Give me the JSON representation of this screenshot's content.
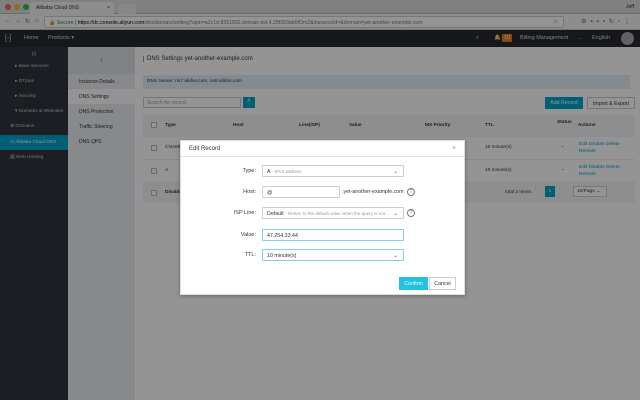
{
  "browser": {
    "tab_title": "Alibaba Cloud DNS",
    "tab_close": "×",
    "user": "Jeff",
    "url_secure": "Secure",
    "url_host": "https://dc.console.aliyun.com",
    "url_rest": "/dns/domain/setting?spm=a2c1d.8251892.domain-list.4.28f399ab0fOm2&instanceId=&domain=yet-another-example.com"
  },
  "header": {
    "home": "Home",
    "products": "Products ▾",
    "notifications": "10",
    "billing": "Billing Management",
    "more": "...",
    "language": "English"
  },
  "sidebar": {
    "items": [
      {
        "label": "Base services"
      },
      {
        "label": "DTplus"
      },
      {
        "label": "Security"
      },
      {
        "label": "Domains & Websites"
      },
      {
        "label": "Domains"
      },
      {
        "label": "Alibaba Cloud DNS"
      },
      {
        "label": "Web Hosting"
      }
    ]
  },
  "subnav": {
    "items": [
      {
        "label": "Instance Details"
      },
      {
        "label": "DNS Settings"
      },
      {
        "label": "DNS Protection"
      },
      {
        "label": "Traffic Steering"
      },
      {
        "label": "DNS QPS"
      }
    ]
  },
  "main": {
    "title": "DNS Settings yet-another-example.com",
    "dns_server": "DNS Server: ns7.alidns.com, ns8.alidns.com",
    "search_placeholder": "Search for record.",
    "add_record": "Add Record",
    "import_export": "Import & Export",
    "columns": [
      "Type",
      "Host",
      "Line(ISP)",
      "Value",
      "MX Priority",
      "TTL",
      "Status",
      "Actions"
    ],
    "rows": [
      {
        "type": "CNAME",
        "ttl": "10 minute(s)",
        "status": "--",
        "actions": [
          "Edit",
          "Disable",
          "Delete",
          "Remark"
        ]
      },
      {
        "type": "A",
        "ttl": "10 minute(s)",
        "status": "--",
        "actions": [
          "Edit",
          "Disable",
          "Delete",
          "Remark"
        ]
      }
    ],
    "footer": {
      "disable": "Disable",
      "total": "total 2 items",
      "page": "1",
      "per_page": "10/Page"
    }
  },
  "modal": {
    "title": "Edit Record",
    "type_label": "Type:",
    "type_value": "A",
    "type_hint": "- IPV4 address",
    "host_label": "Host:",
    "host_value": "@",
    "host_suffix": ".yet-another-example.com",
    "isp_label": "ISP Line:",
    "isp_value": "Default",
    "isp_hint": "- Return to the default value when the query is not...",
    "value_label": "Value:",
    "value_value": "47.254.33.44",
    "ttl_label": "TTL:",
    "ttl_value": "10 minute(s)",
    "confirm": "Confirm",
    "cancel": "Cancel"
  },
  "colors": {
    "accent": "#00a2ca",
    "header_bg": "#262a31",
    "sidebar_bg": "#2f343d"
  }
}
